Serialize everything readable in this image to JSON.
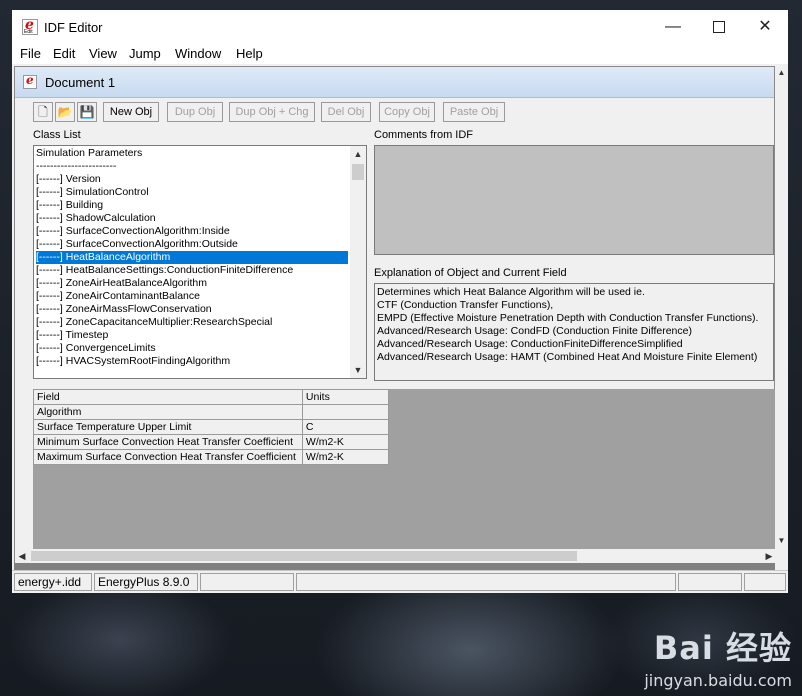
{
  "window": {
    "title": "IDF Editor",
    "icon_label": "Edit"
  },
  "menu": [
    "File",
    "Edit",
    "View",
    "Jump",
    "Window",
    "Help"
  ],
  "document": {
    "title": "Document 1"
  },
  "toolbar": {
    "new_obj": "New Obj",
    "dup_obj": "Dup Obj",
    "dup_obj_chg": "Dup Obj + Chg",
    "del_obj": "Del Obj",
    "copy_obj": "Copy Obj",
    "paste_obj": "Paste Obj"
  },
  "class_list": {
    "label": "Class List",
    "items": [
      "Simulation Parameters",
      "-----------------------",
      "[------]  Version",
      "[------]  SimulationControl",
      "[------]  Building",
      "[------]  ShadowCalculation",
      "[------]  SurfaceConvectionAlgorithm:Inside",
      "[------]  SurfaceConvectionAlgorithm:Outside",
      "[------]  HeatBalanceAlgorithm",
      "[------]  HeatBalanceSettings:ConductionFiniteDifference",
      "[------]  ZoneAirHeatBalanceAlgorithm",
      "[------]  ZoneAirContaminantBalance",
      "[------]  ZoneAirMassFlowConservation",
      "[------]  ZoneCapacitanceMultiplier:ResearchSpecial",
      "[------]  Timestep",
      "[------]  ConvergenceLimits",
      "[------]  HVACSystemRootFindingAlgorithm"
    ],
    "selected_index": 8
  },
  "comments": {
    "label": "Comments from IDF"
  },
  "explanation": {
    "label": "Explanation of Object and Current Field",
    "lines": [
      "Determines which Heat Balance Algorithm will be used ie.",
      "CTF (Conduction Transfer Functions),",
      "EMPD (Effective Moisture Penetration Depth with Conduction Transfer Functions).",
      "Advanced/Research Usage: CondFD (Conduction Finite Difference)",
      "Advanced/Research Usage: ConductionFiniteDifferenceSimplified",
      "Advanced/Research Usage: HAMT (Combined Heat And Moisture Finite Element)"
    ]
  },
  "field_table": {
    "headers": [
      "Field",
      "Units"
    ],
    "rows": [
      [
        "Algorithm",
        ""
      ],
      [
        "Surface Temperature Upper Limit",
        "C"
      ],
      [
        "Minimum Surface Convection Heat Transfer Coefficient",
        "W/m2-K"
      ],
      [
        "Maximum Surface Convection Heat Transfer Coefficient",
        "W/m2-K"
      ]
    ]
  },
  "status": [
    "energy+.idd",
    "EnergyPlus 8.9.0",
    "",
    "",
    "",
    ""
  ],
  "watermark": {
    "logo": "Bai 经验",
    "url": "jingyan.baidu.com"
  }
}
